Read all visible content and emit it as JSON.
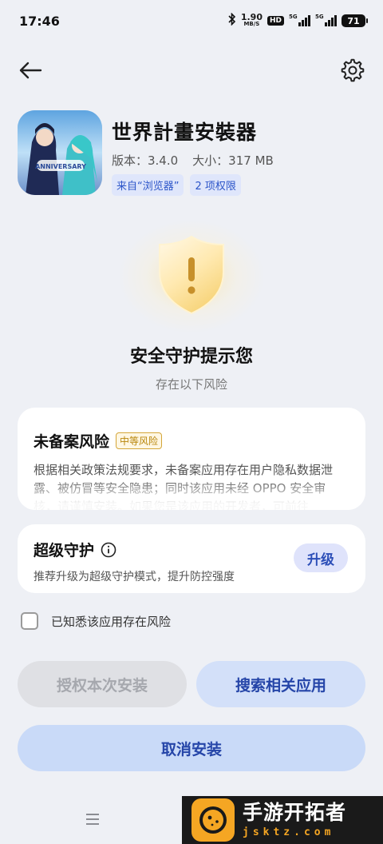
{
  "status_bar": {
    "time": "17:46",
    "net_speed_value": "1.90",
    "net_speed_unit": "MB/S",
    "hd_badge": "HD",
    "signal_1_label": "5G",
    "signal_2_label": "5G",
    "battery": "71"
  },
  "app": {
    "name": "世界計畫安裝器",
    "version": "版本：3.4.0",
    "size": "大小：317 MB",
    "source_tag": "来自“浏览器”",
    "permission_tag": "2 项权限"
  },
  "warning": {
    "title": "安全守护提示您",
    "subtitle": "存在以下风险"
  },
  "risk_card": {
    "title": "未备案风险",
    "level": "中等风险",
    "description": "根据相关政策法规要求，未备案应用存在用户隐私数据泄露、被仿冒等安全隐患；同时该应用未经 OPPO 安全审核，请谨慎安装。如果您是该应用的开发者，可前往"
  },
  "super_protect": {
    "title": "超级守护",
    "description": "推荐升级为超级守护模式，提升防控强度",
    "upgrade_label": "升级"
  },
  "acknowledge": {
    "label": "已知悉该应用存在风险",
    "checked": false
  },
  "buttons": {
    "authorize": "授权本次安装",
    "search_related": "搜索相关应用",
    "cancel": "取消安装"
  },
  "watermark": {
    "name": "手游开拓者",
    "url": "jsktz.com"
  },
  "colors": {
    "accent": "#2545a8",
    "risk_medium": "#b8860b",
    "background": "#eef0f5"
  }
}
